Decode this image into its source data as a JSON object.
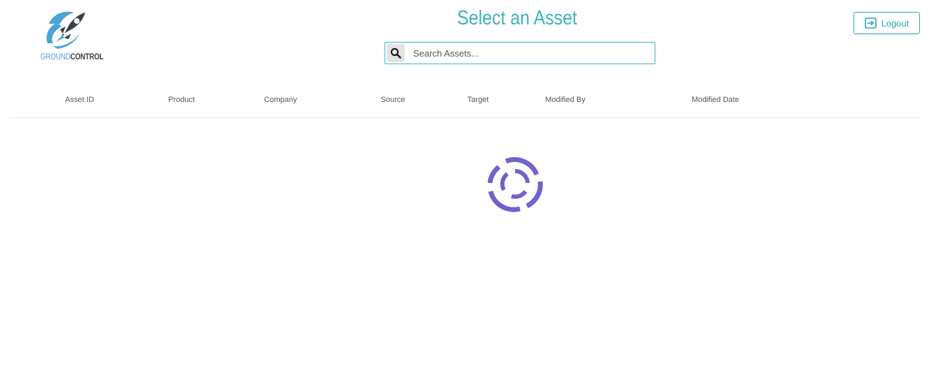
{
  "logo": {
    "icon": "rocket-logo-icon",
    "text_light": "GROUND",
    "text_bold": "CONTROL",
    "colors": {
      "light": "#4ea3d6",
      "dark": "#3a3f45"
    }
  },
  "header": {
    "title": "Select an Asset"
  },
  "search": {
    "icon": "search-icon",
    "placeholder": "Search Assets...",
    "value": ""
  },
  "logout": {
    "icon": "logout-icon",
    "label": "Logout"
  },
  "table": {
    "columns": [
      "Asset ID",
      "Product",
      "Company",
      "Source",
      "Target",
      "Modified By",
      "Modified Date"
    ],
    "rows": []
  },
  "loading": {
    "icon": "loading-spinner-icon",
    "color": "#6f63cf"
  },
  "colors": {
    "accent": "#3bb3bd",
    "spinner": "#6f63cf"
  }
}
